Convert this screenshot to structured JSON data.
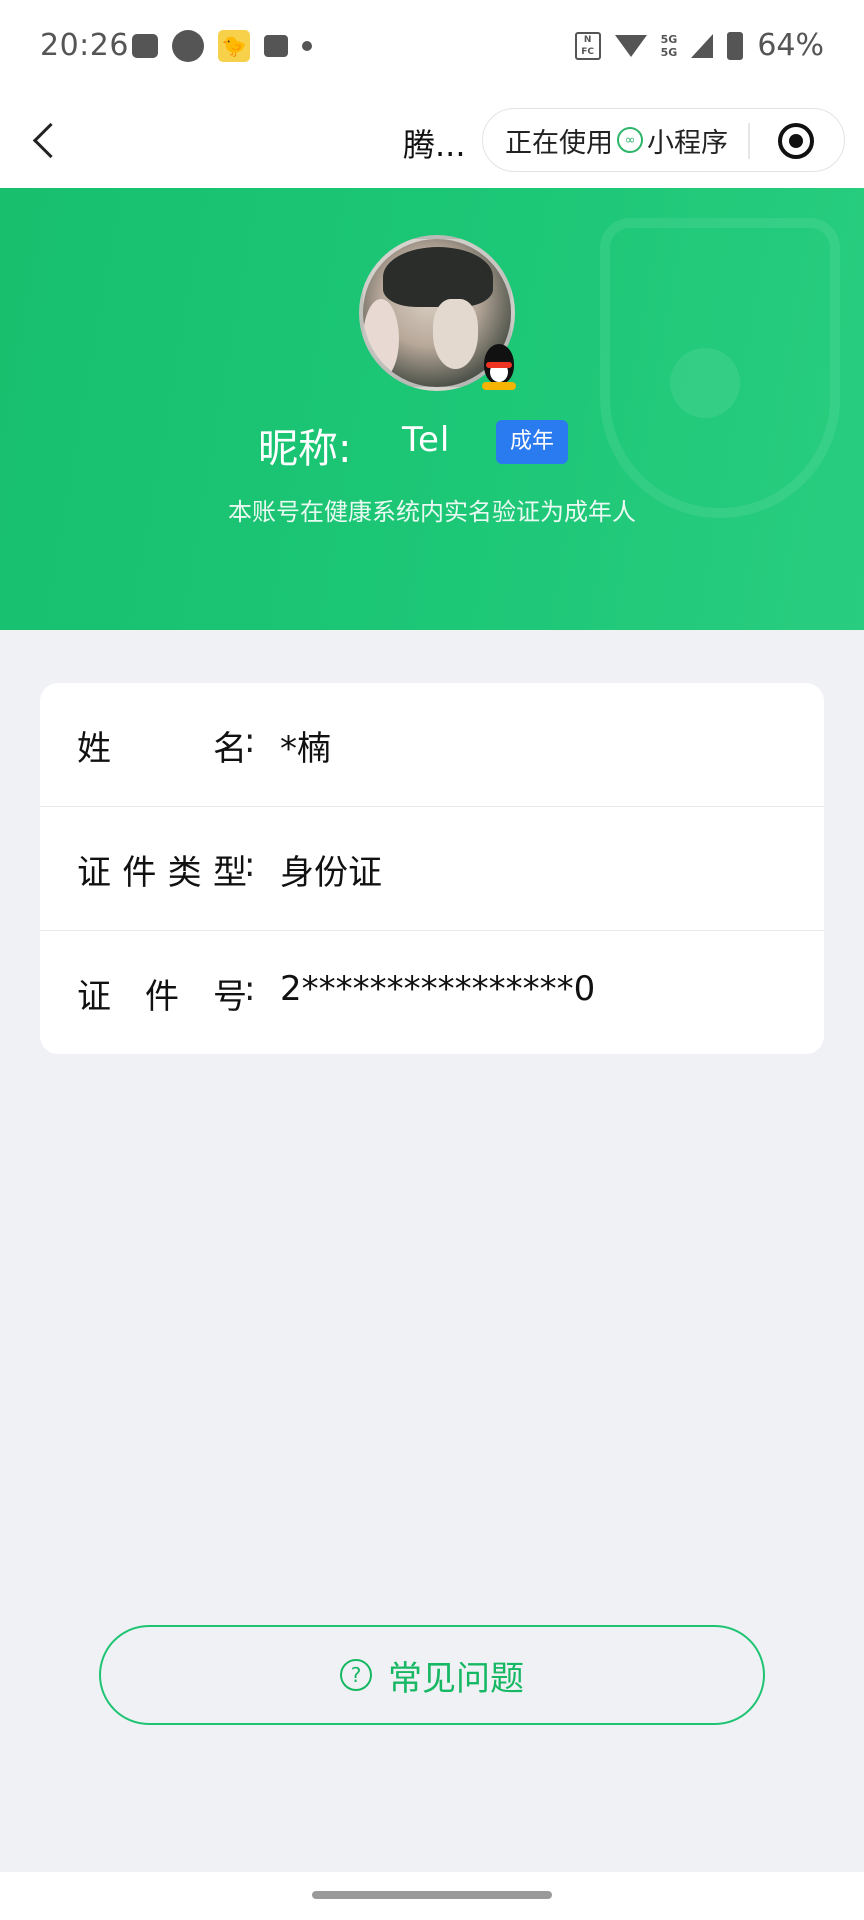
{
  "status_bar": {
    "time": "20:26",
    "battery": "64%",
    "network": "5G",
    "icons": [
      "message-icon",
      "circle-icon",
      "duck-app-icon",
      "mail-icon",
      "dot-icon",
      "nfc-icon",
      "wifi-icon",
      "signal-icon",
      "battery-icon"
    ]
  },
  "nav": {
    "title": "腾...",
    "capsule_text_a": "正在使用",
    "capsule_text_b": "小程序"
  },
  "profile": {
    "nick_label": "昵称:",
    "nick_value": "Tel",
    "badge": "成年",
    "verify_text": "本账号在健康系统内实名验证为成年人"
  },
  "info": {
    "rows": [
      {
        "label_chars": [
          "姓",
          "名"
        ],
        "colon": ":",
        "value": "*楠"
      },
      {
        "label_chars": [
          "证",
          "件",
          "类",
          "型"
        ],
        "colon": ":",
        "value": "身份证"
      },
      {
        "label_chars": [
          "证",
          "件",
          "号"
        ],
        "colon": ":",
        "value": "2****************0"
      }
    ]
  },
  "faq": {
    "icon_glyph": "?",
    "label": "常见问题"
  },
  "colors": {
    "brand_green": "#1cc776",
    "badge_blue": "#2b7bf0",
    "page_bg": "#f0f1f5"
  }
}
